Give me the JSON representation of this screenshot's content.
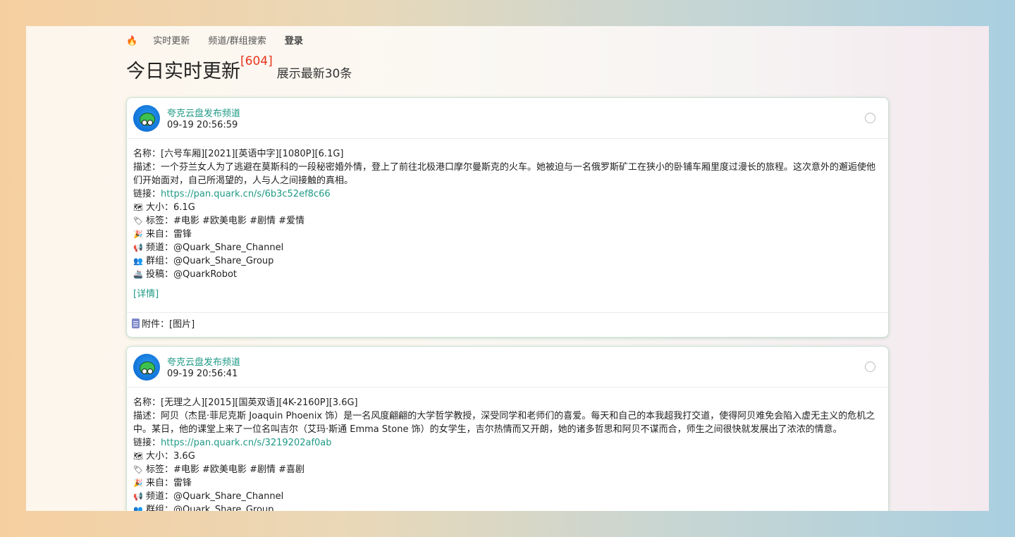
{
  "nav": {
    "live": "实时更新",
    "search": "频道/群组搜索",
    "login": "登录"
  },
  "heading": {
    "title": "今日实时更新",
    "count": "[604]",
    "subtitle": "展示最新30条"
  },
  "posts": [
    {
      "channel": "夸克云盘发布频道",
      "time": "09-19 20:56:59",
      "name_label": "名称：",
      "name": "[六号车厢][2021][英语中字][1080P][6.1G]",
      "desc_label": "描述：",
      "desc": "一个芬兰女人为了逃避在莫斯科的一段秘密婚外情，登上了前往北极港口摩尔曼斯克的火车。她被迫与一名俄罗斯矿工在狭小的卧铺车厢里度过漫长的旅程。这次意外的邂逅使他们开始面对，自己所渴望的，人与人之间接触的真相。",
      "link_label": "链接：",
      "link": "https://pan.quark.cn/s/6b3c52ef8c66",
      "size_label": "大小：",
      "size": "6.1G",
      "tags_label": "标签：",
      "tags": "#电影 #欧美电影 #剧情 #爱情",
      "from_label": "来自：",
      "from": "雷锋",
      "channel_label": "频道：",
      "channel_handle": "@Quark_Share_Channel",
      "group_label": "群组：",
      "group_handle": "@Quark_Share_Group",
      "submit_label": "投稿：",
      "submit_handle": "@QuarkRobot",
      "detail": "[详情]",
      "attach_label": "附件：",
      "attach": "[图片]"
    },
    {
      "channel": "夸克云盘发布频道",
      "time": "09-19 20:56:41",
      "name_label": "名称：",
      "name": "[无理之人][2015][国英双语][4K-2160P][3.6G]",
      "desc_label": "描述：",
      "desc": "阿贝（杰昆·菲尼克斯 Joaquin Phoenix 饰）是一名风度翩翩的大学哲学教授，深受同学和老师们的喜爱。每天和自己的本我超我打交道，使得阿贝难免会陷入虚无主义的危机之中。某日，他的课堂上来了一位名叫吉尔（艾玛·斯通 Emma Stone 饰）的女学生，吉尔热情而又开朗，她的诸多哲思和阿贝不谋而合，师生之间很快就发展出了浓浓的情意。",
      "link_label": "链接：",
      "link": "https://pan.quark.cn/s/3219202af0ab",
      "size_label": "大小：",
      "size": "3.6G",
      "tags_label": "标签：",
      "tags": "#电影 #欧美电影 #剧情 #喜剧",
      "from_label": "来自：",
      "from": "雷锋",
      "channel_label": "频道：",
      "channel_handle": "@Quark_Share_Channel",
      "group_label": "群组：",
      "group_handle": "@Quark_Share_Group"
    }
  ],
  "icons": {
    "flame": "flame-icon",
    "size": "map-icon",
    "tags": "ticket-icon",
    "from": "party-popper-icon",
    "channel": "megaphone-icon",
    "group": "people-icon",
    "submit": "ship-icon",
    "globe": "globe-icon",
    "attach": "document-icon"
  }
}
